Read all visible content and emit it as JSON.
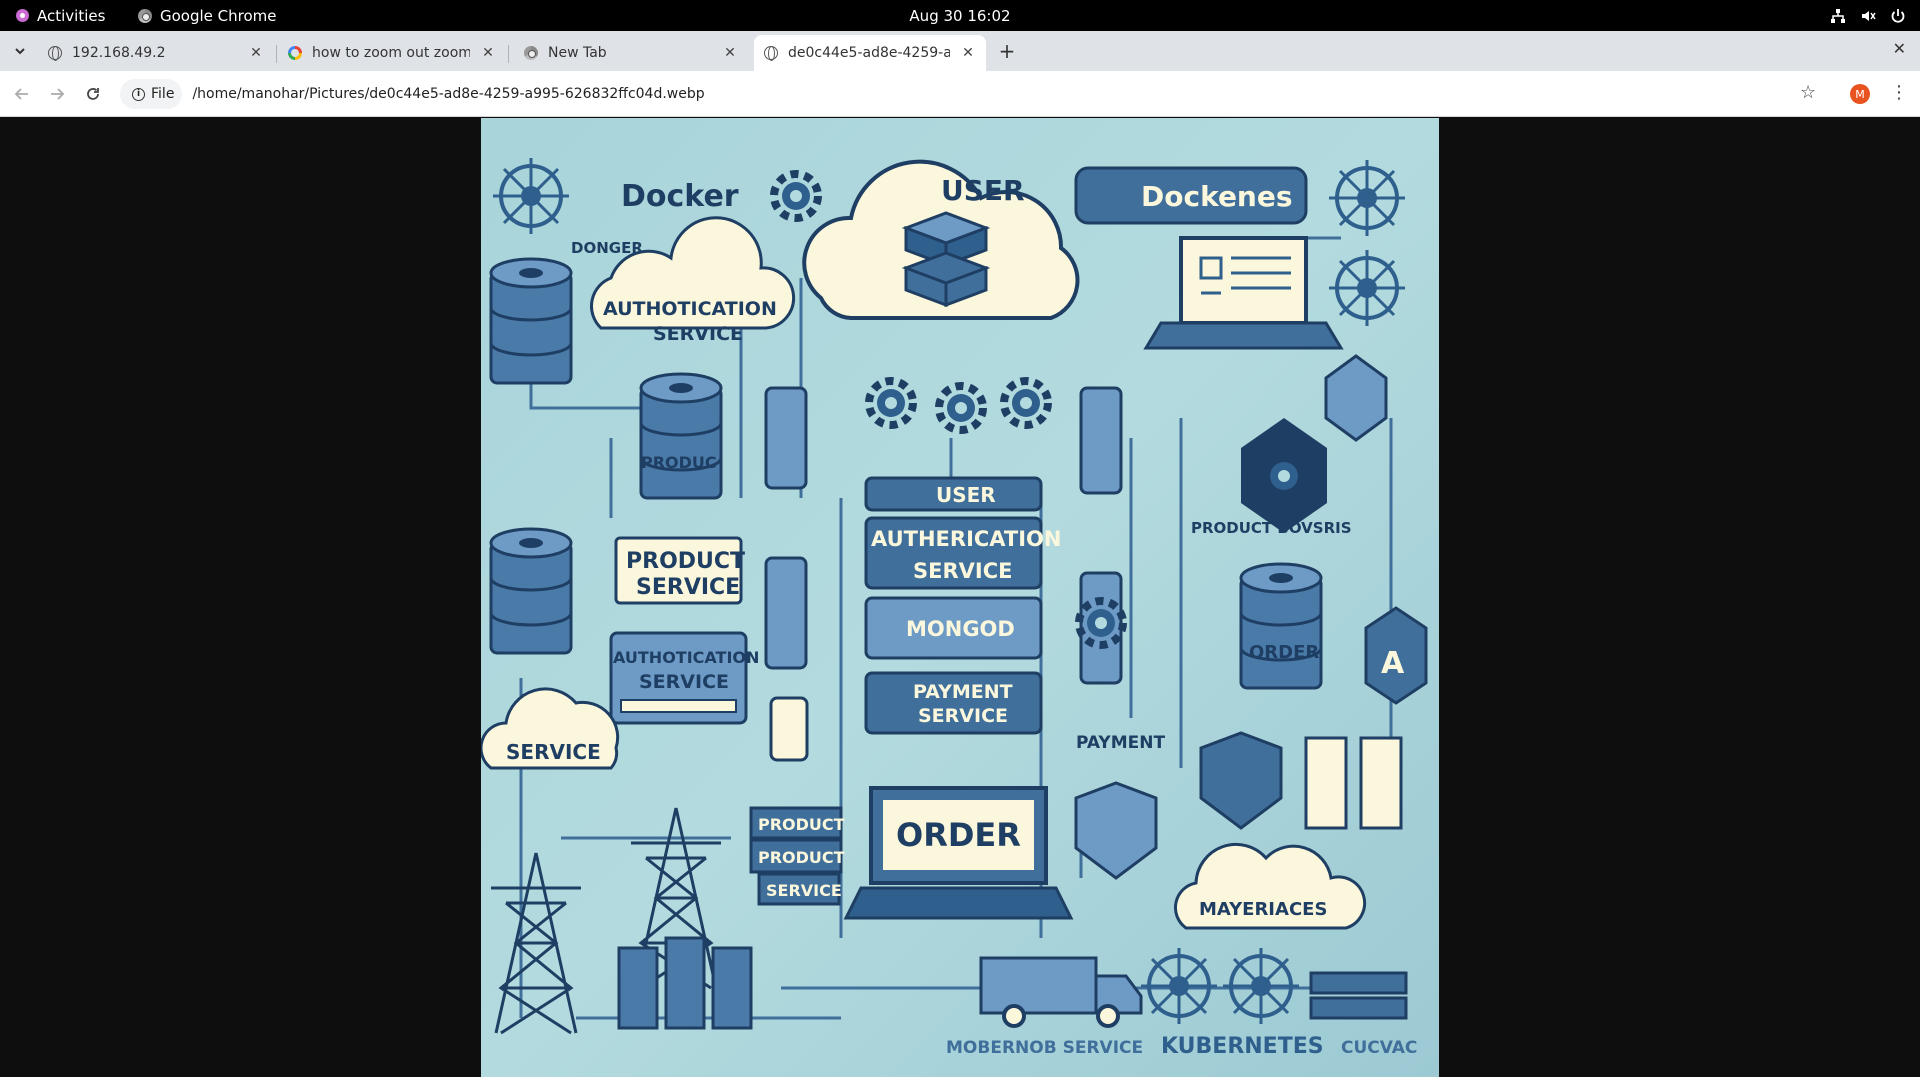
{
  "system_bar": {
    "activities": "Activities",
    "app_name": "Google Chrome",
    "datetime": "Aug 30  16:02"
  },
  "tabs": [
    {
      "title": "192.168.49.2",
      "icon": "globe-icon",
      "active": false
    },
    {
      "title": "how to zoom out zoom in",
      "icon": "google-icon",
      "active": false
    },
    {
      "title": "New Tab",
      "icon": "chrome-icon",
      "active": false
    },
    {
      "title": "de0c44e5-ad8e-4259-a9",
      "icon": "globe-icon",
      "active": true
    }
  ],
  "toolbar": {
    "chip_label": "File",
    "url": "/home/manohar/Pictures/de0c44e5-ad8e-4259-a995-626832ffc04d.webp",
    "avatar_initial": "M"
  },
  "image_labels": {
    "docker": "Docker",
    "docker_sub": "DONGER",
    "dockenes": "Dockenes",
    "user_cloud": "USER",
    "auth_cloud_1": "AUTHOTICATION",
    "auth_cloud_2": "SERVICE",
    "product_db": "PRODUC",
    "product_service_1": "PRODUCT",
    "product_service_2": "SERVICE",
    "auth_service_1": "AUTHOTICATION",
    "auth_service_2": "SERVICE",
    "service_cloud": "SERVICE",
    "user_box": "USER",
    "auth_box_1": "AUTHERICATION",
    "auth_box_2": "SERVICE",
    "mongo_box": "MONGOD",
    "payment_box_1": "PAYMENT",
    "payment_box_2": "SERVICE",
    "product_bovs": "PRODUCT BOVSRIS",
    "order_db": "ORDER",
    "payment": "PAYMENT",
    "order_screen": "ORDER",
    "stack_1": "PRODUCT",
    "stack_2": "PRODUCT",
    "stack_3": "SERVICE",
    "mayeriaces": "MAYERIACES",
    "footer_1": "MOBERNOB SERVICE",
    "footer_2": "KUBERNETES",
    "footer_3": "CUCVAC"
  },
  "colors": {
    "image_bg": "#a8d4da",
    "dark_blue": "#1f3e63",
    "mid_blue": "#3f6f9a",
    "cream": "#fbf7dc"
  }
}
